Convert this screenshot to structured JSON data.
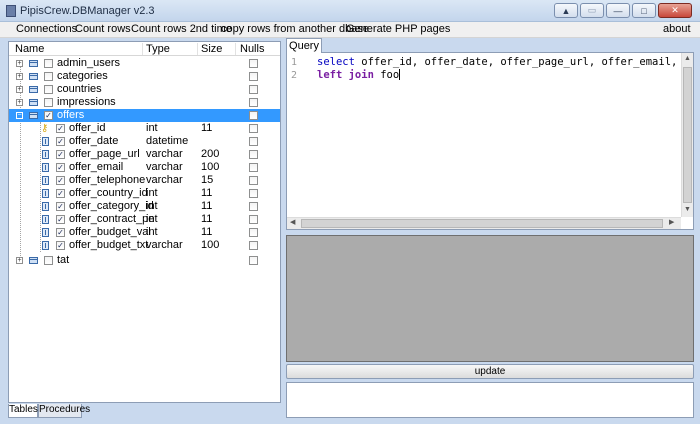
{
  "window": {
    "title": "PipisCrew.DBManager v2.3"
  },
  "menu": [
    {
      "label": "Connections"
    },
    {
      "label": "Count rows"
    },
    {
      "label": "Count rows 2nd time"
    },
    {
      "label": "copy rows from another dbase"
    },
    {
      "label": "Generate PHP pages"
    },
    {
      "label": "about"
    }
  ],
  "tree": {
    "headers": {
      "name": "Name",
      "type": "Type",
      "size": "Size",
      "nulls": "Nulls"
    },
    "tables_top": [
      {
        "name": "admin_users"
      },
      {
        "name": "categories"
      },
      {
        "name": "countries"
      },
      {
        "name": "impressions"
      }
    ],
    "selected_table": {
      "name": "offers"
    },
    "columns": [
      {
        "name": "offer_id",
        "type": "int",
        "size": "11"
      },
      {
        "name": "offer_date",
        "type": "datetime",
        "size": ""
      },
      {
        "name": "offer_page_url",
        "type": "varchar",
        "size": "200"
      },
      {
        "name": "offer_email",
        "type": "varchar",
        "size": "100"
      },
      {
        "name": "offer_telephone",
        "type": "varchar",
        "size": "15"
      },
      {
        "name": "offer_country_id",
        "type": "int",
        "size": "11"
      },
      {
        "name": "offer_category_id",
        "type": "int",
        "size": "11"
      },
      {
        "name": "offer_contract_pe",
        "type": "int",
        "size": "11"
      },
      {
        "name": "offer_budget_val",
        "type": "int",
        "size": "11"
      },
      {
        "name": "offer_budget_txt",
        "type": "varchar",
        "size": "100"
      }
    ],
    "tables_bottom": [
      {
        "name": "tat"
      }
    ]
  },
  "left_tabs": [
    {
      "label": "Tables"
    },
    {
      "label": "Procedures"
    }
  ],
  "query": {
    "tab_label": "Query",
    "lines": [
      {
        "num": "1",
        "kw": "select",
        "rest": " offer_id, offer_date, offer_page_url, offer_email, offer_te"
      },
      {
        "num": "2",
        "kw": "left join",
        "rest": " foo"
      }
    ]
  },
  "update_button": {
    "label": "update"
  },
  "icons": {
    "expand": "plus-icon",
    "collapse": "minus-icon",
    "table": "table-icon",
    "column": "column-icon",
    "primary_key": "key-icon"
  },
  "colors": {
    "selection": "#3399ff",
    "keyword": "#0000c0",
    "join_keyword": "#7a1fa2",
    "result_grid": "#ababab"
  }
}
